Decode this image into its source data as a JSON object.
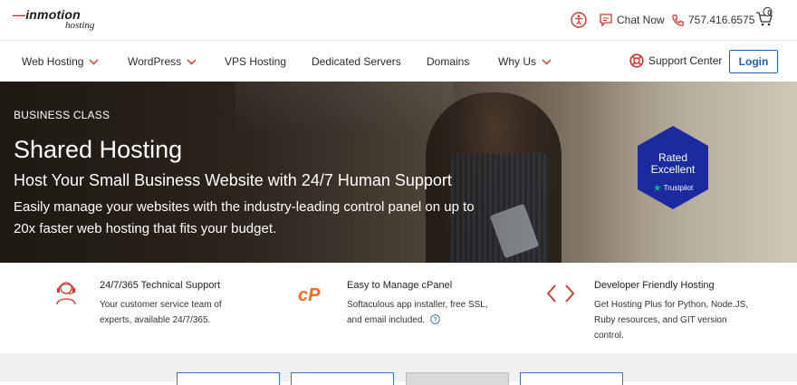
{
  "brand": {
    "name": "inmotion",
    "sub": "hosting"
  },
  "utility": {
    "chat_label": "Chat Now",
    "phone": "757.416.6575",
    "cart_count": "0"
  },
  "nav": {
    "items": [
      {
        "label": "Web Hosting",
        "dropdown": true
      },
      {
        "label": "WordPress",
        "dropdown": true
      },
      {
        "label": "VPS Hosting",
        "dropdown": false
      },
      {
        "label": "Dedicated Servers",
        "dropdown": false
      },
      {
        "label": "Domains",
        "dropdown": false
      },
      {
        "label": "Why Us",
        "dropdown": true
      }
    ],
    "support_label": "Support Center",
    "login_label": "Login"
  },
  "hero": {
    "eyebrow": "BUSINESS CLASS",
    "title": "Shared Hosting",
    "subtitle": "Host Your Small Business Website with 24/7 Human Support",
    "body_line1": "Easily manage your websites with the industry-leading control panel on up to",
    "body_line2": "20x faster web hosting that fits your budget."
  },
  "badge": {
    "line1": "Rated",
    "line2": "Excellent",
    "source": "Trustpilot"
  },
  "features": [
    {
      "icon": "headset-support-icon",
      "title": "24/7/365 Technical Support",
      "desc": [
        "Your customer service team of",
        "experts, available 24/7/365."
      ]
    },
    {
      "icon": "cpanel-logo-icon",
      "title": "Easy to Manage cPanel",
      "desc": [
        "Softaculous app installer, free SSL,",
        "and email included."
      ]
    },
    {
      "icon": "code-brackets-icon",
      "title": "Developer Friendly Hosting",
      "desc": [
        "Get Hosting Plus for Python, Node.JS,",
        "Ruby resources, and GIT version",
        "control."
      ]
    }
  ],
  "colors": {
    "accent": "#d9342b",
    "link_blue": "#1f5fbf",
    "badge_navy": "#1b2a9e",
    "trustpilot_green": "#00b67a"
  }
}
